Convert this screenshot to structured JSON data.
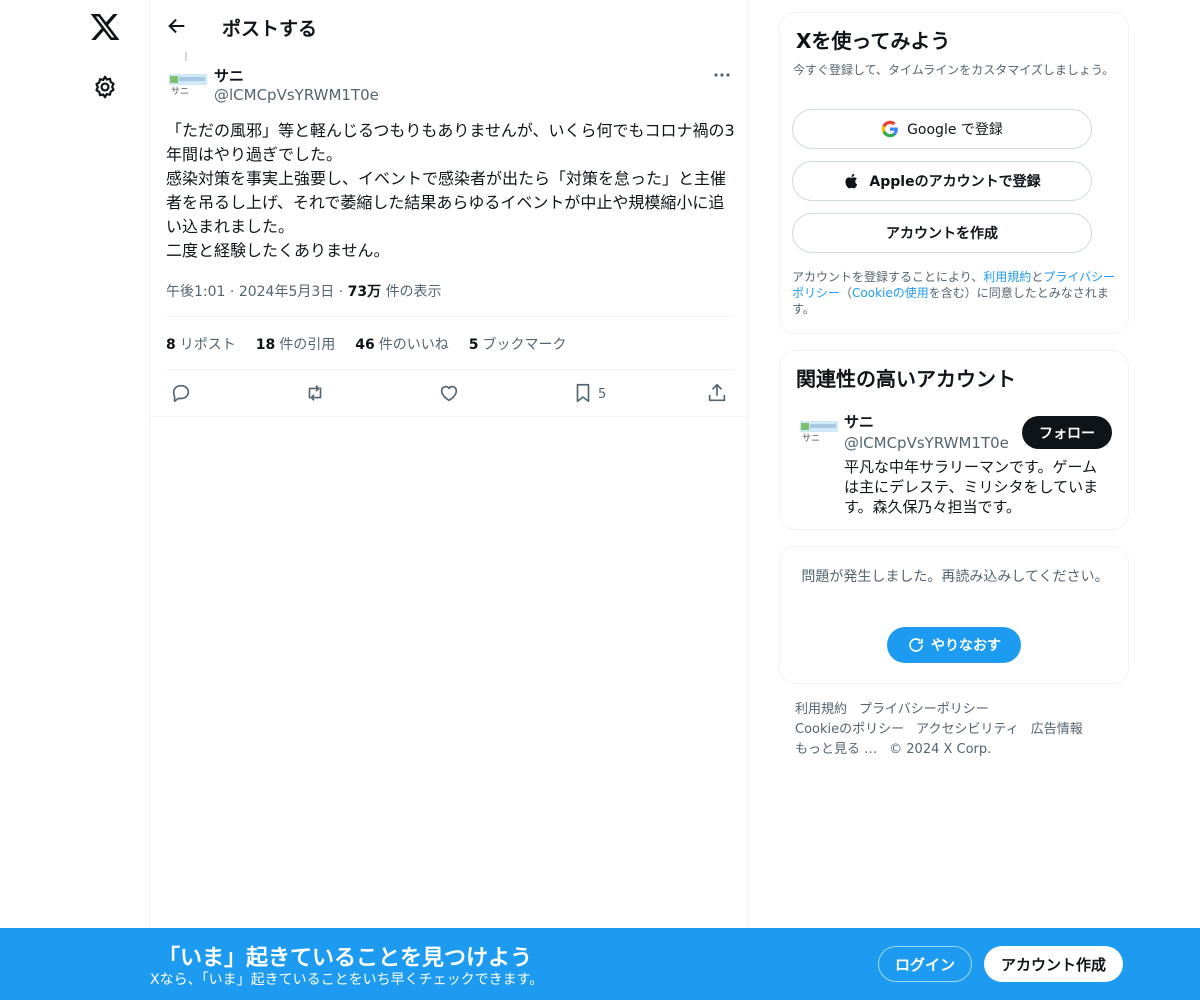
{
  "nav": {
    "logo_icon": "x-logo-icon",
    "settings_icon": "gear-icon"
  },
  "header": {
    "title": "ポストする",
    "back_icon": "arrow-left-icon"
  },
  "post": {
    "author_name": "サニ",
    "author_handle": "@lCMCpVsYRWM1T0e",
    "text": "「ただの風邪」等と軽んじるつもりもありませんが、いくら何でもコロナ禍の3年間はやり過ぎでした。\n感染対策を事実上強要し、イベントで感染者が出たら「対策を怠った」と主催者を吊るし上げ、それで萎縮した結果あらゆるイベントが中止や規模縮小に追い込まれました。\n二度と経験したくありません。",
    "time": "午後1:01",
    "date": "2024年5月3日",
    "views": "73万",
    "views_label": "件の表示",
    "dot": "·",
    "stats": [
      {
        "count": "8",
        "label": "リポスト"
      },
      {
        "count": "18",
        "label": "件の引用"
      },
      {
        "count": "46",
        "label": "件のいいね"
      },
      {
        "count": "5",
        "label": "ブックマーク"
      }
    ],
    "bookmark_count": "5"
  },
  "signup_card": {
    "title": "Xを使ってみよう",
    "subtitle": "今すぐ登録して、タイムラインをカスタマイズしましょう。",
    "google_label": "Google で登録",
    "apple_label": "Appleのアカウントで登録",
    "create_label": "アカウントを作成",
    "legal_prefix": "アカウントを登録することにより、",
    "legal_terms": "利用規約",
    "legal_and": "と",
    "legal_privacy": "プライバシーポリシー",
    "legal_open": "（",
    "legal_cookie": "Cookieの使用",
    "legal_suffix": "を含む）に同意したとみなされます。"
  },
  "related_card": {
    "title": "関連性の高いアカウント",
    "name": "サニ",
    "handle": "@lCMCpVsYRWM1T0e",
    "follow_label": "フォロー",
    "bio": "平凡な中年サラリーマンです。ゲームは主にデレステ、ミリシタをしています。森久保乃々担当です。"
  },
  "error_card": {
    "message": "問題が発生しました。再読み込みしてください。",
    "retry_label": "やりなおす"
  },
  "footer": {
    "terms": "利用規約",
    "privacy": "プライバシーポリシー",
    "cookie": "Cookieのポリシー",
    "accessibility": "アクセシビリティ",
    "ads": "広告情報",
    "more": "もっと見る …",
    "copyright": "© 2024 X Corp."
  },
  "bottom_bar": {
    "title": "「いま」起きていることを見つけよう",
    "subtitle": "Xなら、「いま」起きていることをいち早くチェックできます。",
    "login_label": "ログイン",
    "signup_label": "アカウント作成"
  },
  "colors": {
    "accent": "#1d9bf0",
    "text": "#0f1419",
    "muted": "#536471",
    "border": "#eff3f4"
  }
}
